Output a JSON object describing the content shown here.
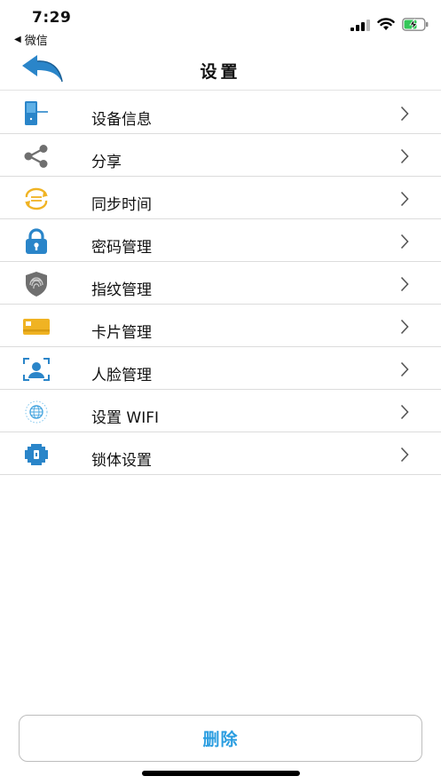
{
  "status_bar": {
    "time": "7:29",
    "back_app": "微信"
  },
  "nav": {
    "title": "设置"
  },
  "menu": [
    {
      "label": "设备信息",
      "icon": "device-info-icon"
    },
    {
      "label": "分享",
      "icon": "share-icon"
    },
    {
      "label": "同步时间",
      "icon": "sync-time-icon"
    },
    {
      "label": "密码管理",
      "icon": "lock-icon"
    },
    {
      "label": "指纹管理",
      "icon": "fingerprint-icon"
    },
    {
      "label": "卡片管理",
      "icon": "card-icon"
    },
    {
      "label": "人脸管理",
      "icon": "face-icon"
    },
    {
      "label": "设置 WIFI",
      "icon": "wifi-globe-icon"
    },
    {
      "label": "锁体设置",
      "icon": "lock-body-icon"
    }
  ],
  "footer": {
    "delete_label": "删除"
  },
  "colors": {
    "accent_blue": "#2a85c9",
    "delete_text": "#2a9de0",
    "icon_gray": "#6f6f6f",
    "icon_yellow": "#f0b323"
  }
}
